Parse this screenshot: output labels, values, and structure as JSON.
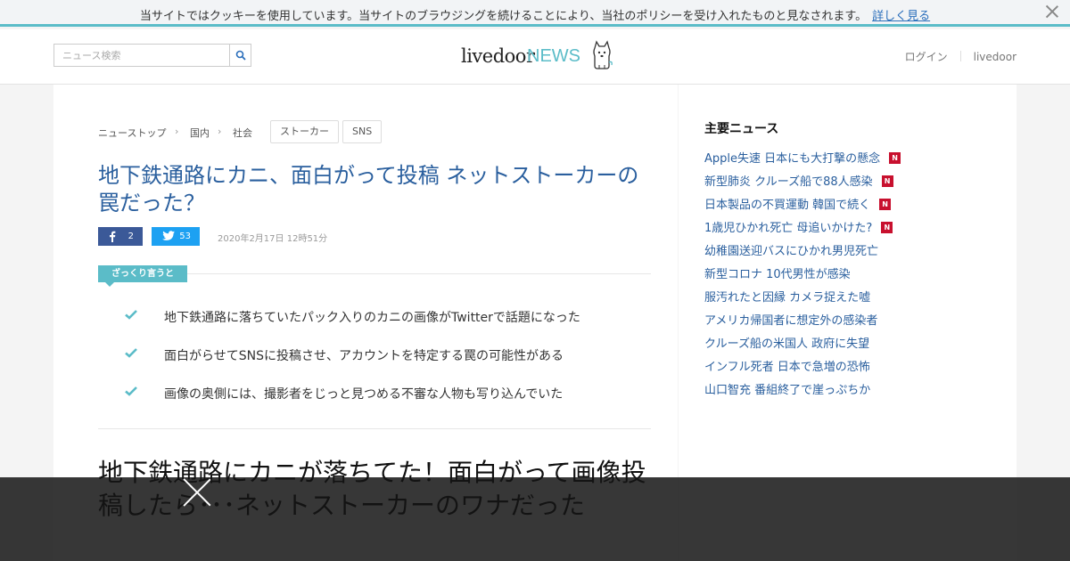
{
  "cookie": {
    "message": "当サイトではクッキーを使用しています。当サイトのブラウジングを続けることにより、当社のポリシーを受け入れたものと見なされます。",
    "link": "詳しく見る"
  },
  "header": {
    "search_placeholder": "ニュース検索",
    "logo_main": "livedoor",
    "logo_sub": "NEWS",
    "nav": [
      "ログイン",
      "livedoor"
    ]
  },
  "article": {
    "breadcrumbs": [
      "ニューストップ",
      "国内",
      "社会"
    ],
    "tags": [
      "ストーカー",
      "SNS"
    ],
    "title": "地下鉄通路にカニ、面白がって投稿 ネットストーカーの罠だった？",
    "share": {
      "facebook_count": "2",
      "twitter_count": "53"
    },
    "date": "2020年2月17日 12時51分",
    "summary_label": "ざっくり言うと",
    "summary_points": [
      "地下鉄通路に落ちていたパック入りのカニの画像がTwitterで話題になった",
      "面白がらせてSNSに投稿させ、アカウントを特定する罠の可能性がある",
      "画像の奥側には、撮影者をじっと見つめる不審な人物も写り込んでいた"
    ],
    "headline": "地下鉄通路にカニが落ちてた！面白がって画像投稿したら･･･ネットストーカーのワナだった"
  },
  "sidebar": {
    "title": "主要ニュース",
    "new_badge": "N",
    "items": [
      {
        "label": "Apple失速 日本にも大打撃の懸念",
        "is_new": true
      },
      {
        "label": "新型肺炎 クルーズ船で88人感染",
        "is_new": true
      },
      {
        "label": "日本製品の不買運動 韓国で続く",
        "is_new": true
      },
      {
        "label": "1歳児ひかれ死亡 母追いかけた?",
        "is_new": true
      },
      {
        "label": "幼稚園送迎バスにひかれ男児死亡",
        "is_new": false
      },
      {
        "label": "新型コロナ 10代男性が感染",
        "is_new": false
      },
      {
        "label": "服汚れたと因縁 カメラ捉えた嘘",
        "is_new": false
      },
      {
        "label": "アメリカ帰国者に想定外の感染者",
        "is_new": false
      },
      {
        "label": "クルーズ船の米国人 政府に失望",
        "is_new": false
      },
      {
        "label": "インフル死者 日本で急増の恐怖",
        "is_new": false
      },
      {
        "label": "山口智充 番組終了で崖っぷちか",
        "is_new": false
      }
    ]
  },
  "colors": {
    "accent": "#5bbcc8",
    "link": "#2a5f9e",
    "facebook": "#3b5998",
    "twitter": "#1da1f2",
    "new_badge": "#c8102e"
  }
}
